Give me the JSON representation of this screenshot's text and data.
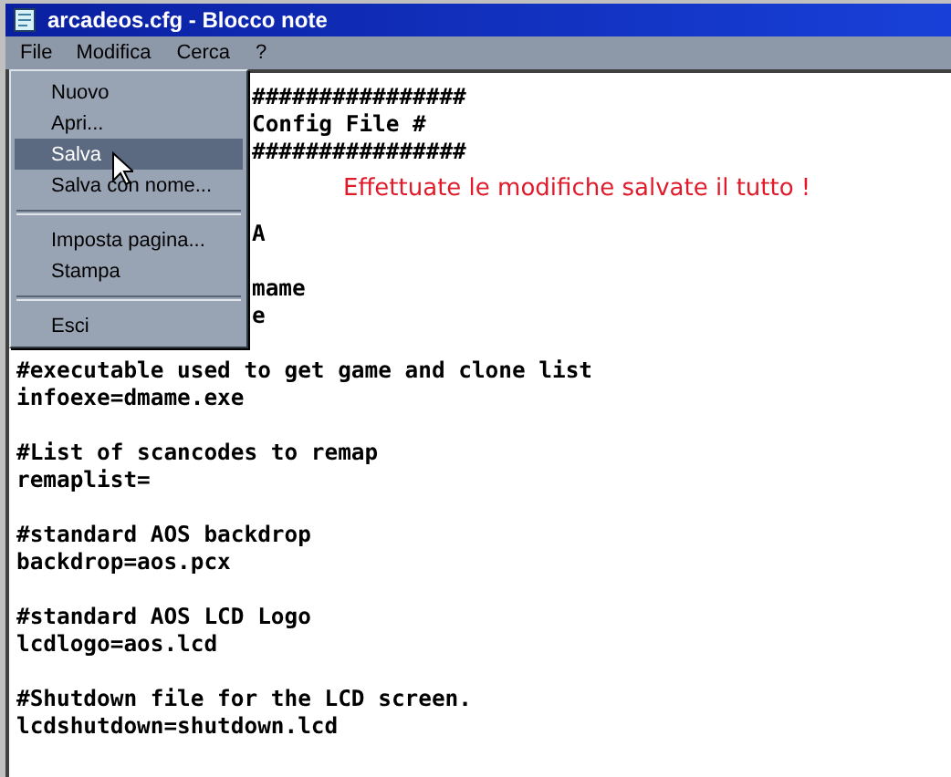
{
  "window": {
    "title": "arcadeos.cfg - Blocco note"
  },
  "menu_bar": [
    {
      "label": "File",
      "selected": true
    },
    {
      "label": "Modifica",
      "selected": false
    },
    {
      "label": "Cerca",
      "selected": false
    },
    {
      "label": "?",
      "selected": false
    }
  ],
  "file_menu": [
    {
      "kind": "item",
      "label": "Nuovo",
      "selected": false
    },
    {
      "kind": "item",
      "label": "Apri...",
      "selected": false
    },
    {
      "kind": "item",
      "label": "Salva",
      "selected": true
    },
    {
      "kind": "item",
      "label": "Salva con nome...",
      "selected": false
    },
    {
      "kind": "separator"
    },
    {
      "kind": "item",
      "label": "Imposta pagina...",
      "selected": false
    },
    {
      "kind": "item",
      "label": "Stampa",
      "selected": false
    },
    {
      "kind": "separator"
    },
    {
      "kind": "item",
      "label": "Esci",
      "selected": false
    }
  ],
  "blocks_beside_menu": [
    [
      "################",
      "Config File #",
      "################"
    ],
    [
      "A"
    ],
    [
      "mame",
      "e"
    ]
  ],
  "blocks": [
    [
      "#executable used to get game and clone list",
      "infoexe=dmame.exe"
    ],
    [
      "#List of scancodes to remap",
      "remaplist="
    ],
    [
      "#standard AOS backdrop",
      "backdrop=aos.pcx"
    ],
    [
      "#standard AOS LCD Logo",
      "lcdlogo=aos.lcd"
    ],
    [
      "#Shutdown file for the LCD screen.",
      "lcdshutdown=shutdown.lcd"
    ]
  ],
  "note": "Effettuate le modifiche salvate il tutto !"
}
